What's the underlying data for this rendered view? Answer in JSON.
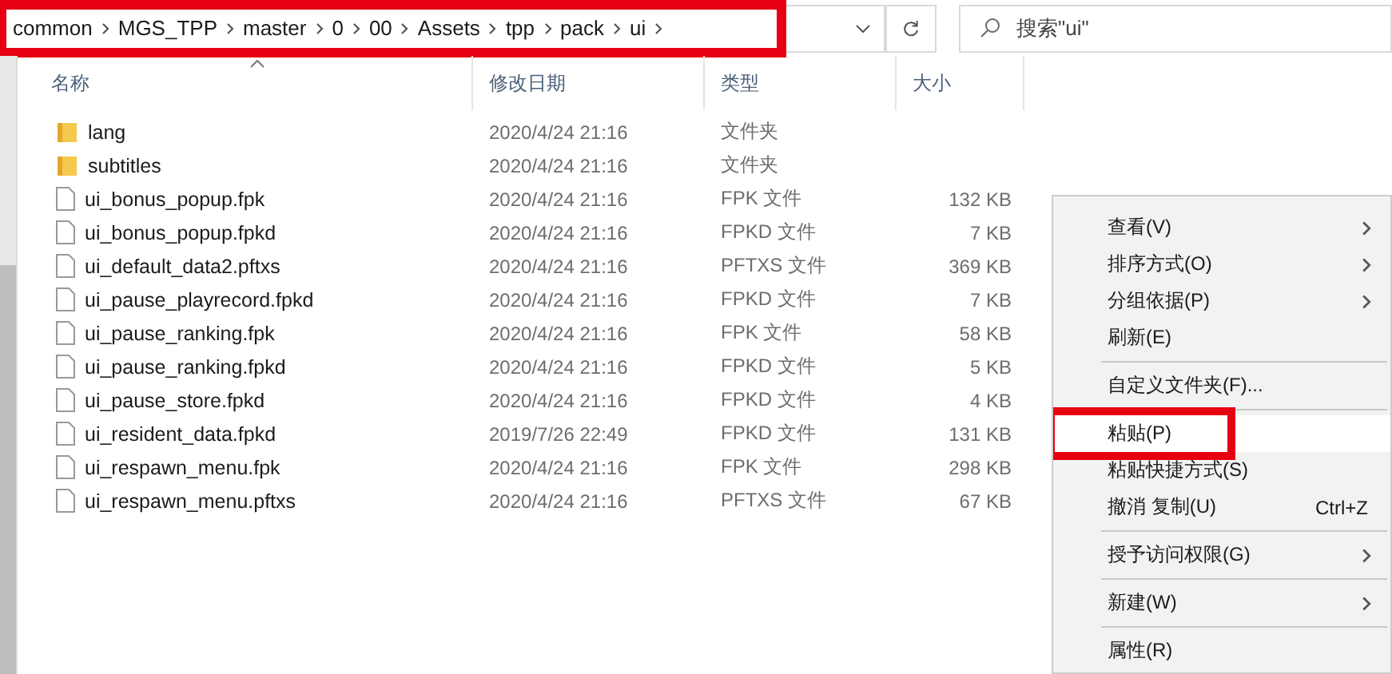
{
  "address_bar": {
    "segments": [
      "common",
      "MGS_TPP",
      "master",
      "0",
      "00",
      "Assets",
      "tpp",
      "pack",
      "ui"
    ],
    "marked": true
  },
  "search": {
    "placeholder": "搜索\"ui\""
  },
  "columns": [
    {
      "label": "名称",
      "sorted": true
    },
    {
      "label": "修改日期",
      "sorted": false
    },
    {
      "label": "类型",
      "sorted": false
    },
    {
      "label": "大小",
      "sorted": false
    }
  ],
  "files": [
    {
      "name": "lang",
      "kind": "folder",
      "modified": "2020/4/24 21:16",
      "type": "文件夹"
    },
    {
      "name": "subtitles",
      "kind": "folder",
      "modified": "2020/4/24 21:16",
      "type": "文件夹"
    },
    {
      "name": "ui_bonus_popup.fpk",
      "kind": "file",
      "modified": "2020/4/24 21:16",
      "type": "FPK 文件",
      "size": "132 KB"
    },
    {
      "name": "ui_bonus_popup.fpkd",
      "kind": "file",
      "modified": "2020/4/24 21:16",
      "type": "FPKD 文件",
      "size": "7 KB"
    },
    {
      "name": "ui_default_data2.pftxs",
      "kind": "file",
      "modified": "2020/4/24 21:16",
      "type": "PFTXS 文件",
      "size": "369 KB"
    },
    {
      "name": "ui_pause_playrecord.fpkd",
      "kind": "file",
      "modified": "2020/4/24 21:16",
      "type": "FPKD 文件",
      "size": "7 KB"
    },
    {
      "name": "ui_pause_ranking.fpk",
      "kind": "file",
      "modified": "2020/4/24 21:16",
      "type": "FPK 文件",
      "size": "58 KB"
    },
    {
      "name": "ui_pause_ranking.fpkd",
      "kind": "file",
      "modified": "2020/4/24 21:16",
      "type": "FPKD 文件",
      "size": "5 KB"
    },
    {
      "name": "ui_pause_store.fpkd",
      "kind": "file",
      "modified": "2020/4/24 21:16",
      "type": "FPKD 文件",
      "size": "4 KB"
    },
    {
      "name": "ui_resident_data.fpkd",
      "kind": "file",
      "modified": "2019/7/26 22:49",
      "type": "FPKD 文件",
      "size": "131 KB"
    },
    {
      "name": "ui_respawn_menu.fpk",
      "kind": "file",
      "modified": "2020/4/24 21:16",
      "type": "FPK 文件",
      "size": "298 KB"
    },
    {
      "name": "ui_respawn_menu.pftxs",
      "kind": "file",
      "modified": "2020/4/24 21:16",
      "type": "PFTXS 文件",
      "size": "67 KB"
    }
  ],
  "context_menu": [
    {
      "kind": "item",
      "label": "查看(V)",
      "submenu": true,
      "selected": false,
      "marked": false
    },
    {
      "kind": "item",
      "label": "排序方式(O)",
      "submenu": true,
      "selected": false,
      "marked": false
    },
    {
      "kind": "item",
      "label": "分组依据(P)",
      "submenu": true,
      "selected": false,
      "marked": false
    },
    {
      "kind": "item",
      "label": "刷新(E)",
      "submenu": false,
      "selected": false,
      "marked": false
    },
    {
      "kind": "separator"
    },
    {
      "kind": "item",
      "label": "自定义文件夹(F)...",
      "submenu": false,
      "selected": false,
      "marked": false
    },
    {
      "kind": "separator"
    },
    {
      "kind": "item",
      "label": "粘贴(P)",
      "submenu": false,
      "selected": true,
      "marked": true
    },
    {
      "kind": "item",
      "label": "粘贴快捷方式(S)",
      "submenu": false,
      "selected": false,
      "marked": false
    },
    {
      "kind": "item",
      "label": "撤消 复制(U)",
      "shortcut": "Ctrl+Z",
      "submenu": false,
      "selected": false,
      "marked": false
    },
    {
      "kind": "separator"
    },
    {
      "kind": "item",
      "label": "授予访问权限(G)",
      "submenu": true,
      "selected": false,
      "marked": false
    },
    {
      "kind": "separator"
    },
    {
      "kind": "item",
      "label": "新建(W)",
      "submenu": true,
      "selected": false,
      "marked": false
    },
    {
      "kind": "separator"
    },
    {
      "kind": "item",
      "label": "属性(R)",
      "submenu": false,
      "selected": false,
      "marked": false
    }
  ]
}
